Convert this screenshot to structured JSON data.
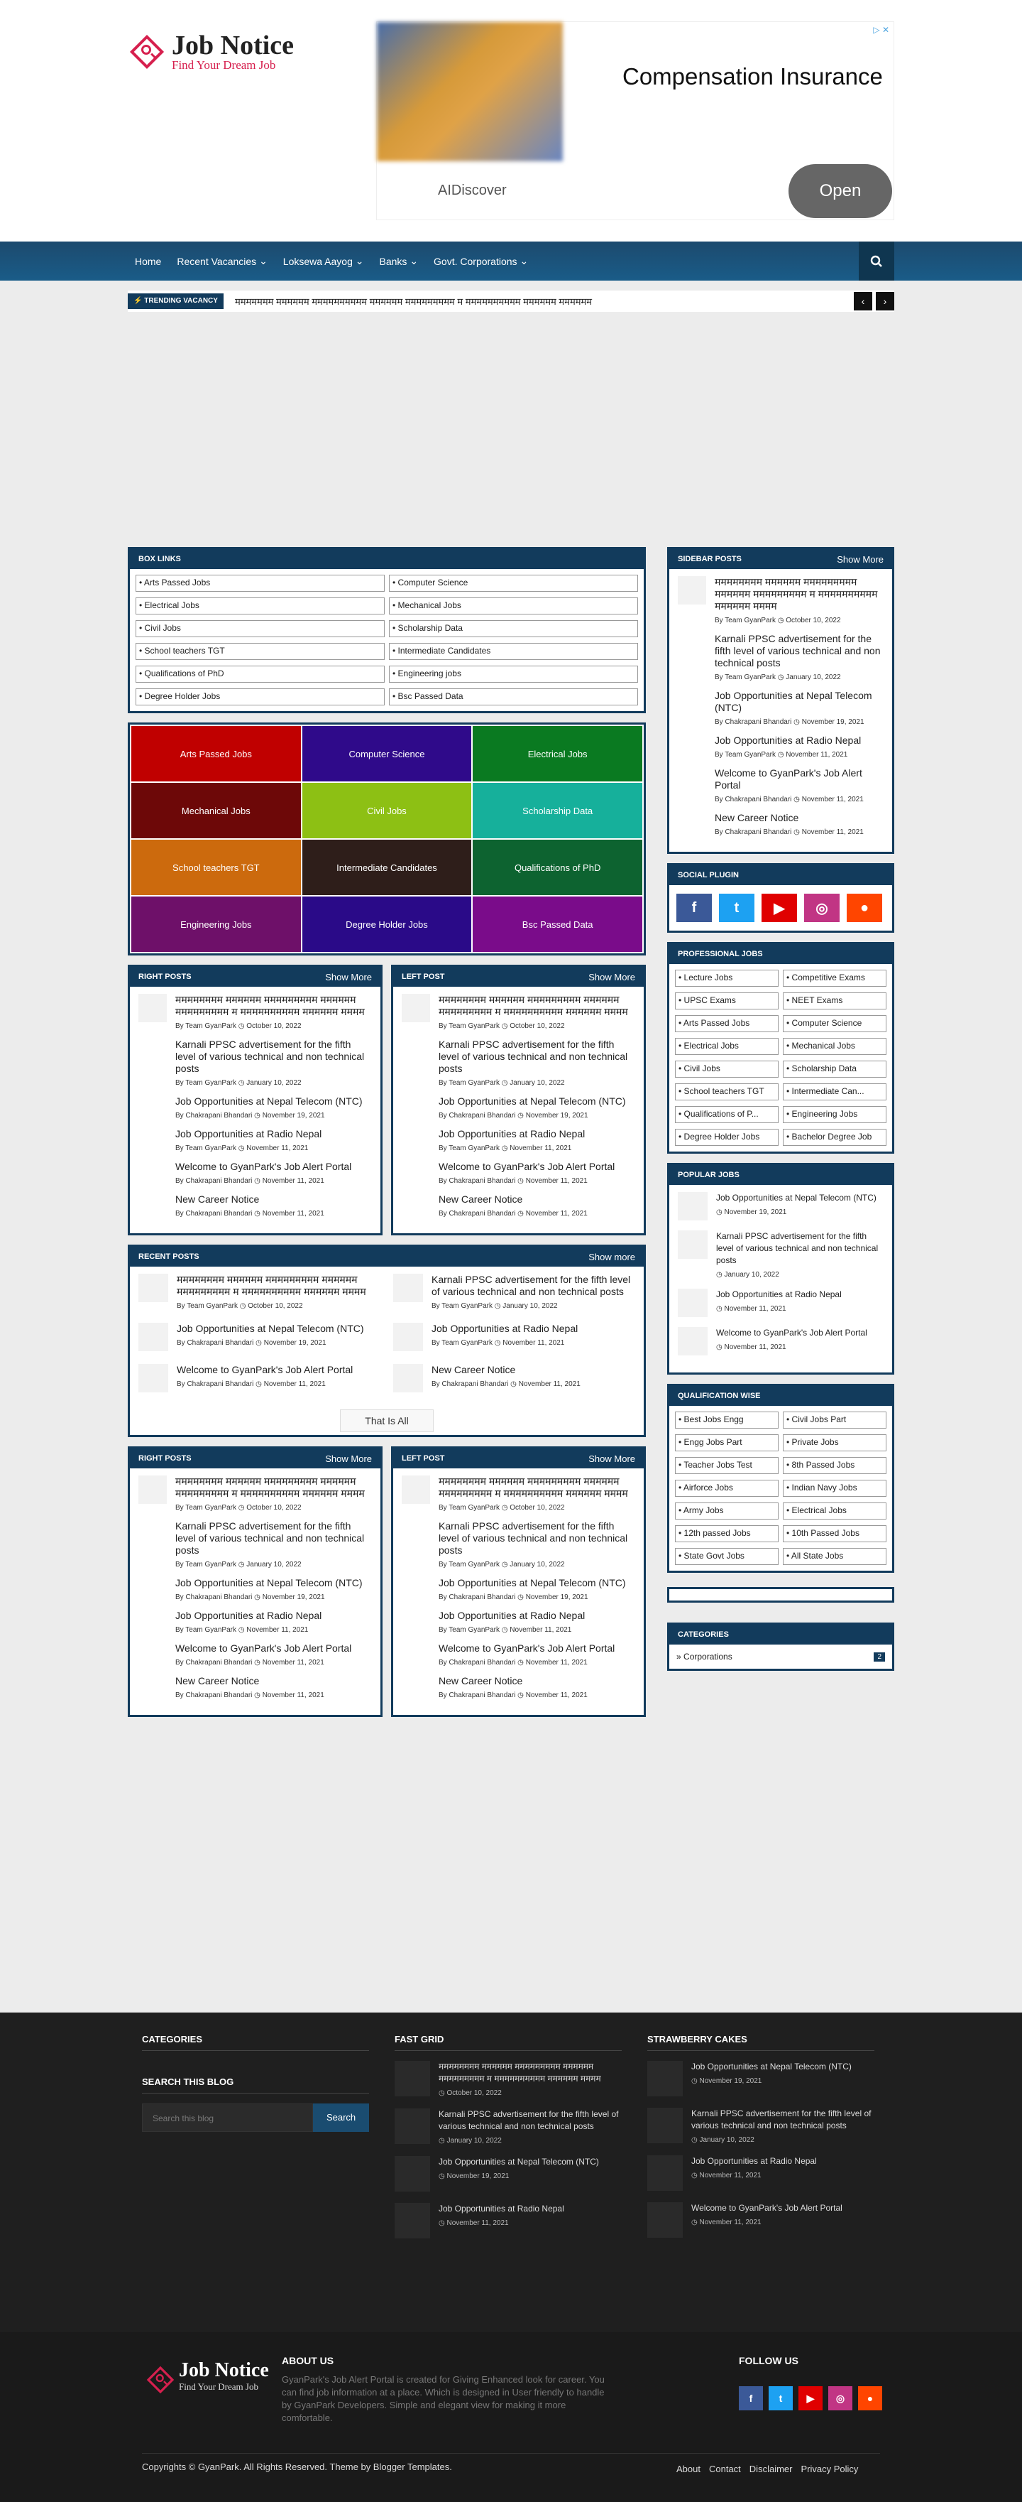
{
  "logo": {
    "title": "Job Notice",
    "subtitle": "Find Your Dream Job"
  },
  "ad": {
    "title": "Compensation Insurance",
    "brand": "AIDiscover",
    "cta": "Open"
  },
  "nav": {
    "items": [
      "Home",
      "Recent Vacancies",
      "Loksewa Aayog",
      "Banks",
      "Govt. Corporations"
    ]
  },
  "trending": {
    "label": "TRENDING VACANCY",
    "text": "ममममममम मममममम मममममममममम मममममम ममममममममम म मममममममममम मममममम मममममम"
  },
  "box_links": {
    "title": "BOX LINKS",
    "items": [
      "Arts Passed Jobs",
      "Computer Science",
      "Electrical Jobs",
      "Mechanical Jobs",
      "Civil Jobs",
      "Scholarship Data",
      "School teachers TGT",
      "Intermediate Candidates",
      "Qualifications of PhD",
      "Engineering jobs",
      "Degree Holder Jobs",
      "Bsc Passed Data"
    ]
  },
  "color_grid": {
    "items": [
      {
        "label": "Arts Passed Jobs",
        "color": "#c00000"
      },
      {
        "label": "Computer Science",
        "color": "#2f0a8a"
      },
      {
        "label": "Electrical Jobs",
        "color": "#0a7a21"
      },
      {
        "label": "Mechanical Jobs",
        "color": "#6d0808"
      },
      {
        "label": "Civil Jobs",
        "color": "#8dc014"
      },
      {
        "label": "Scholarship Data",
        "color": "#16b09b"
      },
      {
        "label": "School teachers TGT",
        "color": "#cc6a0d"
      },
      {
        "label": "Intermediate Candidates",
        "color": "#2e1e1a"
      },
      {
        "label": "Qualifications of PhD",
        "color": "#0d6330"
      },
      {
        "label": "Engineering Jobs",
        "color": "#6e1069"
      },
      {
        "label": "Degree Holder Jobs",
        "color": "#2a0a88"
      },
      {
        "label": "Bsc Passed Data",
        "color": "#7a0c8a"
      }
    ]
  },
  "posts": [
    {
      "title": "मममममममम मममममम ममममममममम मममममम ममममममममम म मममममममममम मममममम मममम",
      "author": "Team GyanPark",
      "date": "October 10, 2022"
    },
    {
      "title": "Karnali PPSC advertisement for the fifth level of various technical and non technical posts",
      "author": "Team GyanPark",
      "date": "January 10, 2022"
    },
    {
      "title": "Job Opportunities at Nepal Telecom (NTC)",
      "author": "Chakrapani Bhandari",
      "date": "November 19, 2021"
    },
    {
      "title": "Job Opportunities at Radio Nepal",
      "author": "Team GyanPark",
      "date": "November 11, 2021"
    },
    {
      "title": "Welcome to GyanPark's Job Alert Portal",
      "author": "Chakrapani Bhandari",
      "date": "November 11, 2021"
    },
    {
      "title": "New Career Notice",
      "author": "Chakrapani Bhandari",
      "date": "November 11, 2021"
    }
  ],
  "right_posts": {
    "title": "RIGHT POSTS",
    "more": "Show More"
  },
  "left_post": {
    "title": "LEFT POST",
    "more": "Show More"
  },
  "recent_posts": {
    "title": "RECENT POSTS",
    "more": "Show more",
    "that_all": "That Is All"
  },
  "sidebar_posts": {
    "title": "SIDEBAR POSTS",
    "more": "Show More"
  },
  "social_plugin": {
    "title": "SOCIAL PLUGIN"
  },
  "professional_jobs": {
    "title": "PROFESSIONAL JOBS",
    "items": [
      "Lecture Jobs",
      "Competitive Exams",
      "UPSC Exams",
      "NEET Exams",
      "Arts Passed Jobs",
      "Computer Science",
      "Electrical Jobs",
      "Mechanical Jobs",
      "Civil Jobs",
      "Scholarship Data",
      "School teachers TGT",
      "Intermediate Can...",
      "Qualifications of P...",
      "Engineering Jobs",
      "Degree Holder Jobs",
      "Bachelor Degree Job"
    ]
  },
  "popular_jobs": {
    "title": "POPULAR JOBS"
  },
  "qualification": {
    "title": "QUALIFICATION WISE",
    "items": [
      "Best Jobs Engg",
      "Civil Jobs Part",
      "Engg Jobs Part",
      "Private Jobs",
      "Teacher Jobs Test",
      "8th Passed Jobs",
      "Airforce Jobs",
      "Indian Navy Jobs",
      "Army Jobs",
      "Electrical Jobs",
      "12th passed Jobs",
      "10th Passed Jobs",
      "State Govt Jobs",
      "All State Jobs"
    ]
  },
  "categories": {
    "title": "CATEGORIES",
    "item": "Corporations",
    "count": "2"
  },
  "footer": {
    "categories": "CATEGORIES",
    "search_title": "SEARCH THIS BLOG",
    "search_placeholder": "Search this blog",
    "search_button": "Search",
    "fast_grid": "FAST GRID",
    "strawberry": "STRAWBERRY CAKES",
    "about_title": "ABOUT US",
    "about_text": "GyanPark's Job Alert Portal is created for Giving Enhanced look for career. You can find job information at a place. Which is designed in User friendly to handle by GyanPark Developers. Simple and elegant view for making it more comfortable.",
    "follow_title": "FOLLOW US",
    "copyright": "Copyrights © GyanPark. All Rights Reserved. Theme by Blogger Templates.",
    "links": [
      "About",
      "Contact",
      "Disclaimer",
      "Privacy Policy"
    ]
  },
  "colors": {
    "primary": "#123b5c",
    "accent": "#d6204e",
    "facebook": "#3b5998",
    "twitter": "#1da1f2",
    "youtube": "#e00000",
    "instagram": "#c13584",
    "reddit": "#ff4500"
  }
}
